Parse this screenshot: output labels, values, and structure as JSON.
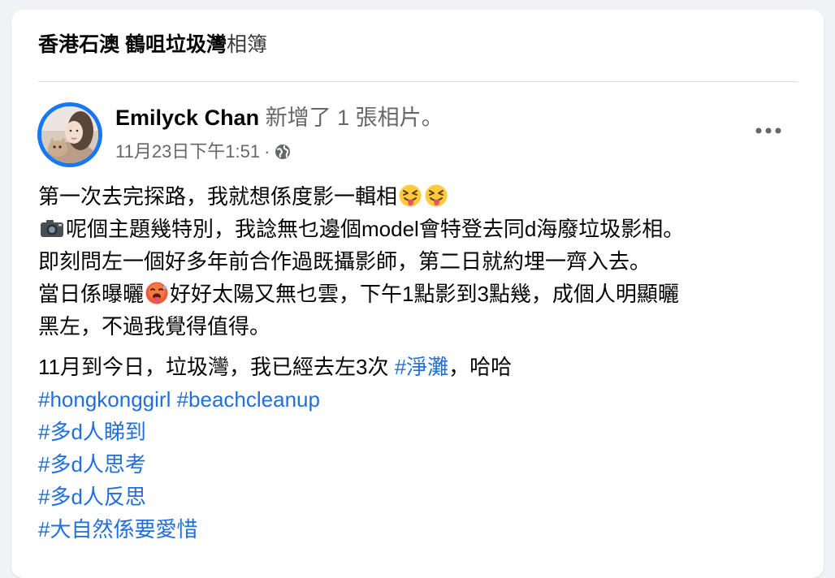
{
  "album": {
    "name": "香港石澳 鶴咀垃圾灣",
    "suffix": "相簿"
  },
  "post": {
    "author": "Emilyck Chan",
    "action": "新增了 1 張相片。",
    "timestamp": "11月23日下午1:51",
    "separator": "·",
    "audience_icon": "globe-icon",
    "more_icon": "more-options-icon",
    "paragraph1": {
      "line1": "第一次去完探路，我就想係度影一輯相",
      "line2": "呢個主題幾特別，我諗無乜邊個model會特登去同d海廢垃圾影相。",
      "line3": "即刻問左一個好多年前合作過既攝影師，第二日就約埋一齊入去。",
      "line4a": "當日係曝曬",
      "line4b": "好好太陽又無乜雲，下午1點影到3點幾，成個人明顯曬",
      "line5": "黑左，不過我覺得值得。"
    },
    "paragraph2": {
      "line1_text": "11月到今日，垃圾灣，我已經去左3次 ",
      "line1_hashtag": "#淨灘",
      "line1_end": "，哈哈",
      "hashtags": {
        "hongkonggirl": "#hongkonggirl",
        "beachcleanup": "#beachcleanup",
        "h1": "#多d人睇到",
        "h2": "#多d人思考",
        "h3": "#多d人反思",
        "h4": "#大自然係要愛惜"
      }
    },
    "emojis": [
      "squinting-tongue-face",
      "squinting-tongue-face",
      "camera",
      "hot-face"
    ]
  },
  "colors": {
    "link": "#216fdb",
    "secondary_text": "#65676b",
    "avatar_ring": "#1877f2",
    "background": "#f0f2f5"
  }
}
